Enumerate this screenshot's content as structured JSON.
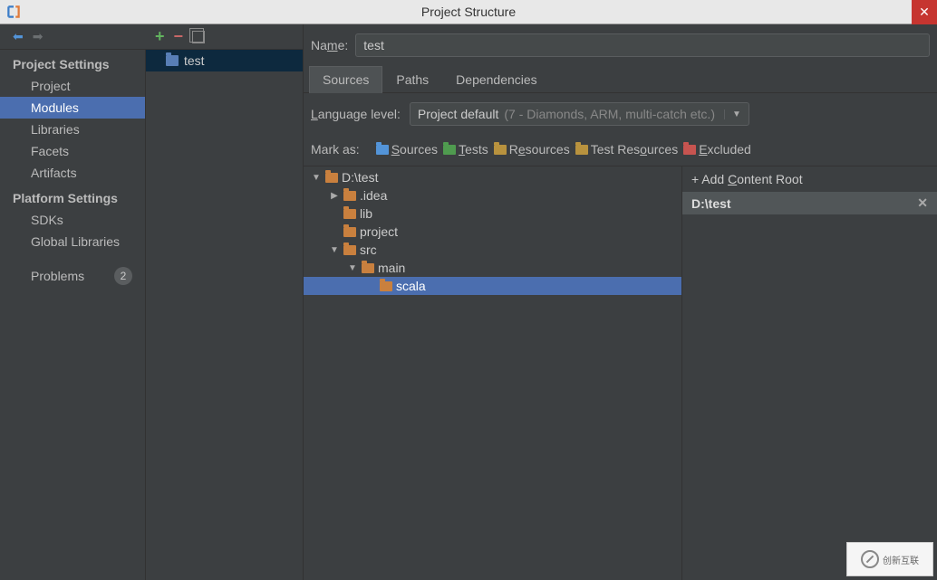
{
  "window": {
    "title": "Project Structure"
  },
  "leftNav": {
    "projectSettings": "Project Settings",
    "items1": [
      "Project",
      "Modules",
      "Libraries",
      "Facets",
      "Artifacts"
    ],
    "platformSettings": "Platform Settings",
    "items2": [
      "SDKs",
      "Global Libraries"
    ],
    "problems": "Problems",
    "problemsCount": "2",
    "selected": "Modules"
  },
  "modulesList": {
    "module": "test"
  },
  "form": {
    "nameLabel": "Name:",
    "nameValue": "test"
  },
  "tabs": {
    "sources": "Sources",
    "paths": "Paths",
    "deps": "Dependencies",
    "active": "Sources"
  },
  "lang": {
    "label": "Language level:",
    "value": "Project default",
    "hint": "(7 - Diamonds, ARM, multi-catch etc.)"
  },
  "markAs": {
    "label": "Mark as:",
    "sources": "Sources",
    "tests": "Tests",
    "resources": "Resources",
    "testResources": "Test Resources",
    "excluded": "Excluded"
  },
  "tree": {
    "root": "D:\\test",
    "idea": ".idea",
    "lib": "lib",
    "project": "project",
    "src": "src",
    "main": "main",
    "scala": "scala"
  },
  "roots": {
    "addLabel": "Add Content Root",
    "entry": "D:\\test"
  },
  "watermark": "创新互联"
}
